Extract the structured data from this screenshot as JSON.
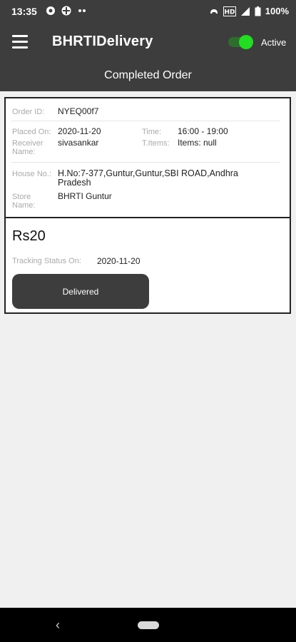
{
  "status_bar": {
    "time": "13:35",
    "left_icons": [
      "circle-dot-icon",
      "grid-icon",
      "more-icon"
    ],
    "right_icons": [
      "gamepad-icon",
      "hd-icon",
      "signal-icon",
      "battery-icon"
    ],
    "hd_text": "HD",
    "battery": "100%"
  },
  "app_bar": {
    "title": "BHRTIDelivery",
    "active_label": "Active",
    "active_on": true,
    "toggle_color": "#22dd22"
  },
  "sub_bar": {
    "title": "Completed Order"
  },
  "order": {
    "order_id_label": "Order ID:",
    "order_id": "NYEQ00f7",
    "placed_on_label": "Placed On:",
    "placed_on": "2020-11-20",
    "time_label": "Time:",
    "time": "16:00 - 19:00",
    "receiver_label": "Receiver Name:",
    "receiver": "sivasankar",
    "items_label": "T.Items:",
    "items": "Items: null",
    "house_label": "House No.:",
    "house": "H.No:7-377,Guntur,Guntur,SBI ROAD,Andhra Pradesh",
    "store_label": "Store Name:",
    "store": "BHRTI Guntur",
    "price": "Rs20",
    "tracking_label": "Tracking Status On:",
    "tracking_date": "2020-11-20",
    "status_button": "Delivered"
  },
  "colors": {
    "header": "#3d3d3d",
    "background": "#f0f0f0"
  },
  "nav_bar": {
    "back_icon": "chevron-left-icon",
    "home_icon": "home-pill-icon"
  }
}
